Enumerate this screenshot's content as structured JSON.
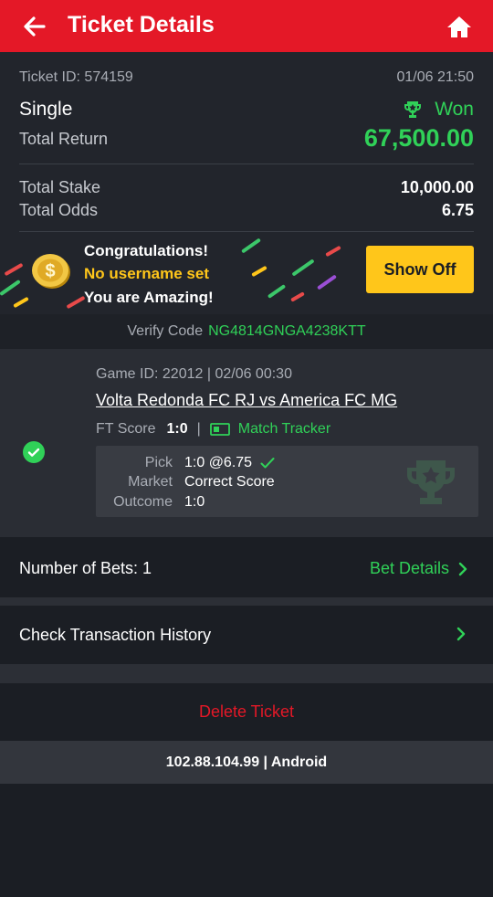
{
  "header": {
    "title": "Ticket Details",
    "back_icon": "arrow-left-icon",
    "home_icon": "home-icon"
  },
  "ticket": {
    "id": "Ticket ID: 574159",
    "datetime": "01/06 21:50",
    "type": "Single",
    "status": "Won",
    "total_return_label": "Total Return",
    "total_return": "67,500.00",
    "total_stake_label": "Total Stake",
    "total_stake": "10,000.00",
    "total_odds_label": "Total Odds",
    "total_odds": "6.75"
  },
  "banner": {
    "line1": "Congratulations!",
    "line2": "No username set",
    "line3": "You are Amazing!",
    "button": "Show Off"
  },
  "verify": {
    "label": "Verify Code",
    "code": "NG4814GNGA4238KTT"
  },
  "game": {
    "game_id": "Game ID: 22012 | 02/06 00:30",
    "match": "Volta Redonda FC RJ vs America FC MG",
    "ft_label": "FT Score",
    "ft_score": "1:0",
    "separator": "|",
    "tracker": "Match Tracker",
    "pick_label": "Pick",
    "pick_value": "1:0 @6.75",
    "market_label": "Market",
    "market_value": "Correct Score",
    "outcome_label": "Outcome",
    "outcome_value": "1:0"
  },
  "bets": {
    "label": "Number of Bets: 1",
    "details": "Bet Details"
  },
  "history": {
    "label": "Check Transaction History"
  },
  "delete": {
    "label": "Delete Ticket"
  },
  "footer": {
    "text": "102.88.104.99 | Android"
  },
  "colors": {
    "brand_red": "#e41827",
    "win_green": "#30d158",
    "accent_yellow": "#ffc61a",
    "background": "#1b1e24"
  }
}
